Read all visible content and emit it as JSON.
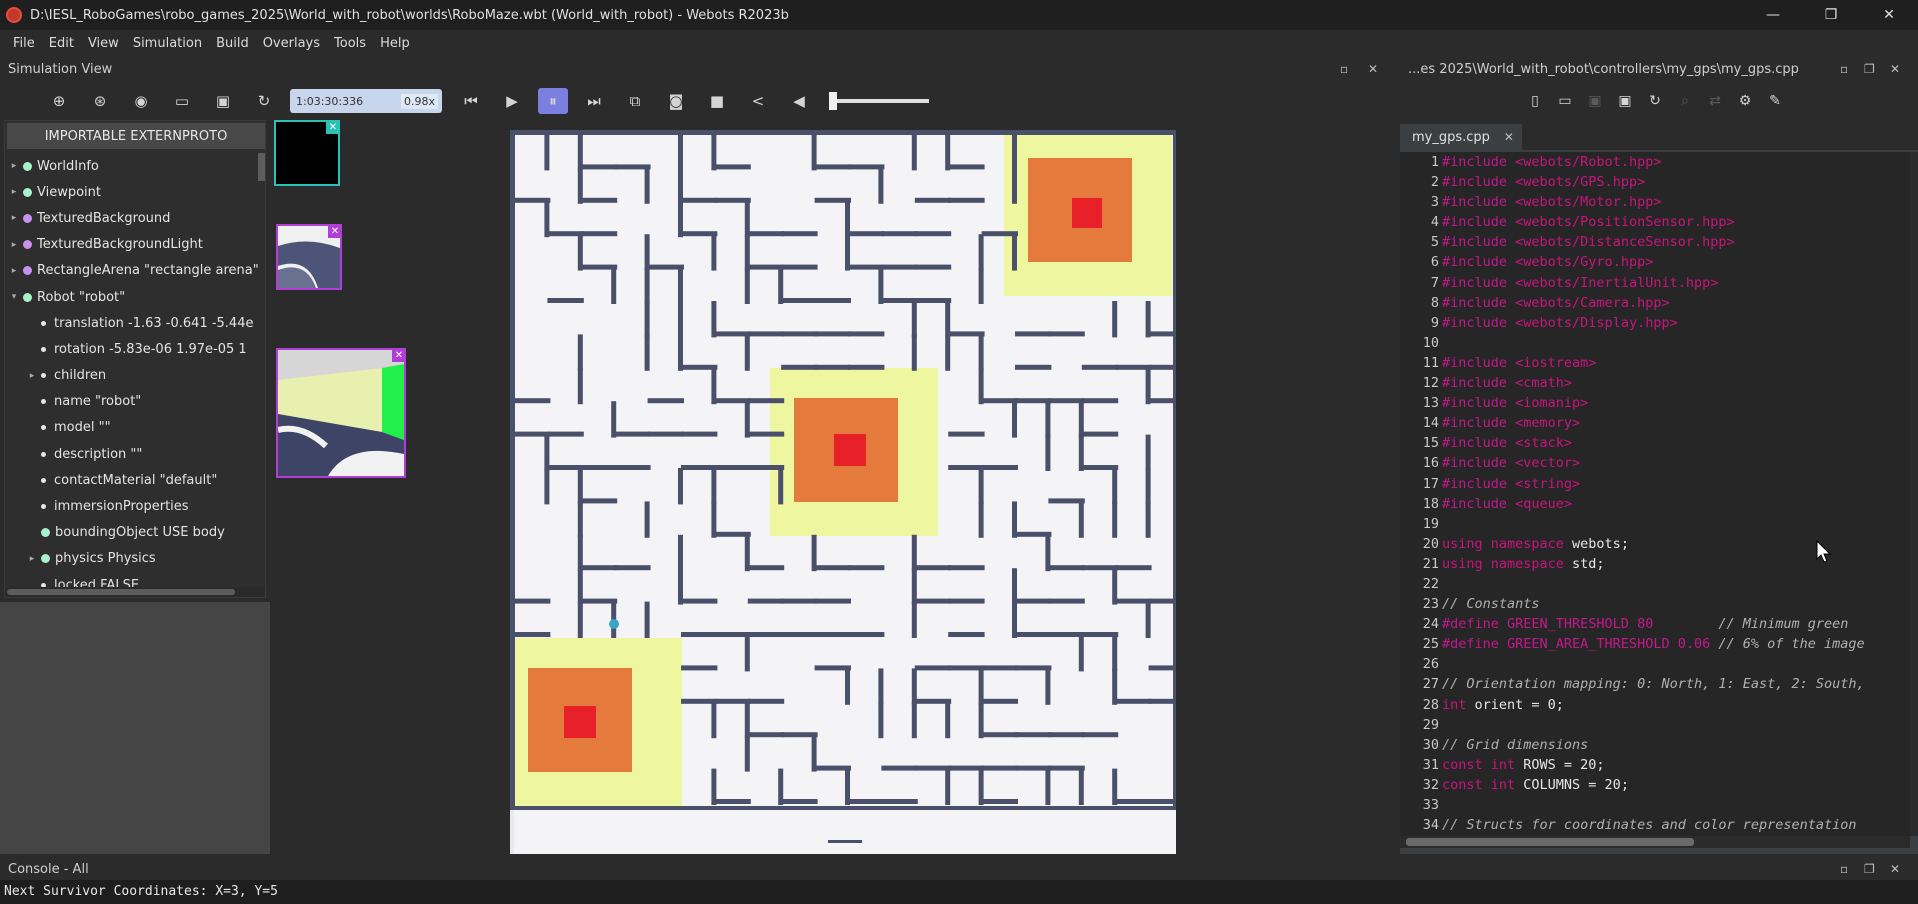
{
  "window": {
    "title": "D:\\IESL_RoboGames\\robo_games_2025\\World_with_robot\\worlds\\RoboMaze.wbt (World_with_robot) - Webots R2023b",
    "minimize": "—",
    "maximize": "❐",
    "close": "✕"
  },
  "menu": [
    "File",
    "Edit",
    "View",
    "Simulation",
    "Build",
    "Overlays",
    "Tools",
    "Help"
  ],
  "simulation_view": {
    "title": "Simulation View",
    "time": "1:03:30:336",
    "speed": "0.98x"
  },
  "editor_panel": {
    "path": "...es 2025\\World_with_robot\\controllers\\my_gps\\my_gps.cpp",
    "tab": "my_gps.cpp"
  },
  "scene_tree": {
    "proto_button": "IMPORTABLE EXTERNPROTO",
    "nodes": [
      {
        "label": "WorldInfo",
        "dot": "green",
        "arrow": "▸",
        "indent": 0
      },
      {
        "label": "Viewpoint",
        "dot": "green",
        "arrow": "▸",
        "indent": 0
      },
      {
        "label": "TexturedBackground",
        "dot": "purple",
        "arrow": "▸",
        "indent": 0
      },
      {
        "label": "TexturedBackgroundLight",
        "dot": "purple",
        "arrow": "▸",
        "indent": 0
      },
      {
        "label": "RectangleArena \"rectangle arena\"",
        "dot": "purple",
        "arrow": "▸",
        "indent": 0
      },
      {
        "label": "Robot \"robot\"",
        "dot": "green",
        "arrow": "▾",
        "indent": 0
      },
      {
        "label": "translation -1.63 -0.641 -5.44e",
        "dot": "white",
        "arrow": "",
        "indent": 1
      },
      {
        "label": "rotation -5.83e-06 1.97e-05 1",
        "dot": "white",
        "arrow": "",
        "indent": 1
      },
      {
        "label": "children",
        "dot": "white",
        "arrow": "▸",
        "indent": 1
      },
      {
        "label": "name \"robot\"",
        "dot": "white",
        "arrow": "",
        "indent": 1
      },
      {
        "label": "model \"\"",
        "dot": "white",
        "arrow": "",
        "indent": 1
      },
      {
        "label": "description \"\"",
        "dot": "white",
        "arrow": "",
        "indent": 1
      },
      {
        "label": "contactMaterial \"default\"",
        "dot": "white",
        "arrow": "",
        "indent": 1
      },
      {
        "label": "immersionProperties",
        "dot": "white",
        "arrow": "",
        "indent": 1
      },
      {
        "label": "boundingObject USE body",
        "dot": "green",
        "arrow": "",
        "indent": 1
      },
      {
        "label": "physics Physics",
        "dot": "green",
        "arrow": "▸",
        "indent": 1
      },
      {
        "label": "locked FALSE",
        "dot": "white",
        "arrow": "",
        "indent": 1
      }
    ]
  },
  "code_lines": [
    {
      "n": "1",
      "parts": [
        [
          "kw-dir",
          "#include "
        ],
        [
          "str",
          "<webots/Robot.hpp>"
        ]
      ]
    },
    {
      "n": "2",
      "parts": [
        [
          "kw-dir",
          "#include "
        ],
        [
          "str",
          "<webots/GPS.hpp>"
        ]
      ]
    },
    {
      "n": "3",
      "parts": [
        [
          "kw-dir",
          "#include "
        ],
        [
          "str",
          "<webots/Motor.hpp>"
        ]
      ]
    },
    {
      "n": "4",
      "parts": [
        [
          "kw-dir",
          "#include "
        ],
        [
          "str",
          "<webots/PositionSensor.hpp>"
        ]
      ]
    },
    {
      "n": "5",
      "parts": [
        [
          "kw-dir",
          "#include "
        ],
        [
          "str",
          "<webots/DistanceSensor.hpp>"
        ]
      ]
    },
    {
      "n": "6",
      "parts": [
        [
          "kw-dir",
          "#include "
        ],
        [
          "str",
          "<webots/Gyro.hpp>"
        ]
      ]
    },
    {
      "n": "7",
      "parts": [
        [
          "kw-dir",
          "#include "
        ],
        [
          "str",
          "<webots/InertialUnit.hpp>"
        ]
      ]
    },
    {
      "n": "8",
      "parts": [
        [
          "kw-dir",
          "#include "
        ],
        [
          "str",
          "<webots/Camera.hpp>"
        ]
      ]
    },
    {
      "n": "9",
      "parts": [
        [
          "kw-dir",
          "#include "
        ],
        [
          "str",
          "<webots/Display.hpp>"
        ]
      ]
    },
    {
      "n": "10",
      "parts": []
    },
    {
      "n": "11",
      "parts": [
        [
          "kw-dir",
          "#include "
        ],
        [
          "str",
          "<iostream>"
        ]
      ]
    },
    {
      "n": "12",
      "parts": [
        [
          "kw-dir",
          "#include "
        ],
        [
          "str",
          "<cmath>"
        ]
      ]
    },
    {
      "n": "13",
      "parts": [
        [
          "kw-dir",
          "#include "
        ],
        [
          "str",
          "<iomanip>"
        ]
      ]
    },
    {
      "n": "14",
      "parts": [
        [
          "kw-dir",
          "#include "
        ],
        [
          "str",
          "<memory>"
        ]
      ]
    },
    {
      "n": "15",
      "parts": [
        [
          "kw-dir",
          "#include "
        ],
        [
          "str",
          "<stack>"
        ]
      ]
    },
    {
      "n": "16",
      "parts": [
        [
          "kw-dir",
          "#include "
        ],
        [
          "str",
          "<vector>"
        ]
      ]
    },
    {
      "n": "17",
      "parts": [
        [
          "kw-dir",
          "#include "
        ],
        [
          "str",
          "<string>"
        ]
      ]
    },
    {
      "n": "18",
      "parts": [
        [
          "kw-dir",
          "#include "
        ],
        [
          "str",
          "<queue>"
        ]
      ]
    },
    {
      "n": "19",
      "parts": []
    },
    {
      "n": "20",
      "parts": [
        [
          "kw",
          "using namespace "
        ],
        [
          "plain",
          "webots;"
        ]
      ]
    },
    {
      "n": "21",
      "parts": [
        [
          "kw",
          "using namespace "
        ],
        [
          "plain",
          "std;"
        ]
      ]
    },
    {
      "n": "22",
      "parts": []
    },
    {
      "n": "23",
      "parts": [
        [
          "comment",
          "// Constants"
        ]
      ]
    },
    {
      "n": "24",
      "parts": [
        [
          "kw-dir",
          "#define GREEN_THRESHOLD 80        "
        ],
        [
          "comment",
          "// Minimum green"
        ]
      ]
    },
    {
      "n": "25",
      "parts": [
        [
          "kw-dir",
          "#define GREEN_AREA_THRESHOLD 0.06 "
        ],
        [
          "comment",
          "// 6% of the image"
        ]
      ]
    },
    {
      "n": "26",
      "parts": []
    },
    {
      "n": "27",
      "parts": [
        [
          "comment",
          "// Orientation mapping: 0: North, 1: East, 2: South,"
        ]
      ]
    },
    {
      "n": "28",
      "parts": [
        [
          "kw",
          "int "
        ],
        [
          "plain",
          "orient = 0;"
        ]
      ]
    },
    {
      "n": "29",
      "parts": []
    },
    {
      "n": "30",
      "parts": [
        [
          "comment",
          "// Grid dimensions"
        ]
      ]
    },
    {
      "n": "31",
      "parts": [
        [
          "kw",
          "const int "
        ],
        [
          "plain",
          "ROWS = 20;"
        ]
      ]
    },
    {
      "n": "32",
      "parts": [
        [
          "kw",
          "const int "
        ],
        [
          "plain",
          "COLUMNS = 20;"
        ]
      ]
    },
    {
      "n": "33",
      "parts": []
    },
    {
      "n": "34",
      "parts": [
        [
          "comment",
          "// Structs for coordinates and color representation"
        ]
      ]
    }
  ],
  "console": {
    "title": "Console - All",
    "output": "Next Survivor Coordinates: X=3, Y=5"
  },
  "colors": {
    "maze_floor": "#f4f4f6",
    "maze_wall": "#4a4f6a",
    "zone_yellow": "#eef6a0",
    "zone_orange": "#e47a3c",
    "zone_red": "#e8202a"
  }
}
